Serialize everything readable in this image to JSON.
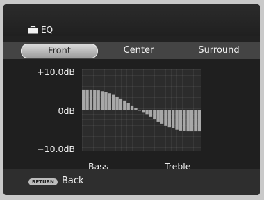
{
  "header": {
    "title": "EQ",
    "icon": "toolbox-icon"
  },
  "tabs": [
    {
      "label": "Front",
      "active": true
    },
    {
      "label": "Center",
      "active": false
    },
    {
      "label": "Surround",
      "active": false
    }
  ],
  "chart": {
    "ylabels": {
      "top": "+10.0dB",
      "mid": "0dB",
      "bottom": "−10.0dB"
    },
    "xlabels": {
      "left": "Bass",
      "right": "Treble"
    }
  },
  "chart_data": {
    "type": "bar",
    "ylim": [
      -10,
      10
    ],
    "values": [
      5.1,
      5.1,
      5.1,
      5.0,
      4.9,
      4.7,
      4.5,
      4.2,
      3.8,
      3.4,
      2.9,
      2.4,
      1.8,
      1.2,
      0.6,
      0.1,
      -0.4,
      -0.9,
      -1.5,
      -2.1,
      -2.7,
      -3.2,
      -3.7,
      -4.1,
      -4.4,
      -4.7,
      -4.9,
      -5.0,
      -5.1,
      -5.1,
      -5.1,
      -5.1
    ],
    "bar_color": "#a8a8a8",
    "grid": true
  },
  "footer": {
    "return_label": "RETURN",
    "back_label": "Back"
  }
}
